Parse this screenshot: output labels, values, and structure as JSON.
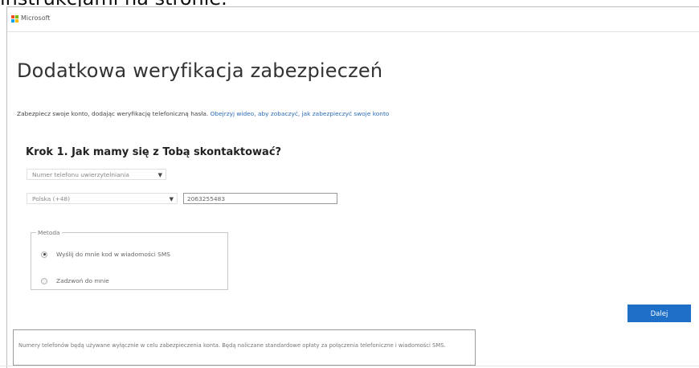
{
  "caption": "instrukcjami na stronie.",
  "header": {
    "brand": "Microsoft",
    "logo_colors": [
      "#f25022",
      "#7fba00",
      "#00a4ef",
      "#ffb900"
    ]
  },
  "page": {
    "title": "Dodatkowa weryfikacja zabezpieczeń",
    "intro_text": "Zabezpiecz swoje konto, dodając weryfikację telefoniczną hasła.",
    "intro_link": "Obejrzyj wideo, aby zobaczyć, jak zabezpieczyć swoje konto"
  },
  "step1": {
    "heading": "Krok 1. Jak mamy się z Tobą skontaktować?",
    "contact_method_select": "Numer telefonu uwierzytelniania",
    "country_select": "Polska (+48)",
    "phone_value": "2063255483"
  },
  "method": {
    "legend": "Metoda",
    "options": [
      {
        "label": "Wyślij do mnie kod w wiadomości SMS",
        "checked": true
      },
      {
        "label": "Zadzwoń do mnie",
        "checked": false
      }
    ]
  },
  "actions": {
    "next_label": "Dalej"
  },
  "notice": "Numery telefonów będą używane wyłącznie w celu zabezpieczenia konta. Będą naliczane standardowe opłaty za połączenia telefoniczne i wiadomości SMS.",
  "colors": {
    "accent": "#1e6fc7",
    "link": "#2b6cb5"
  }
}
